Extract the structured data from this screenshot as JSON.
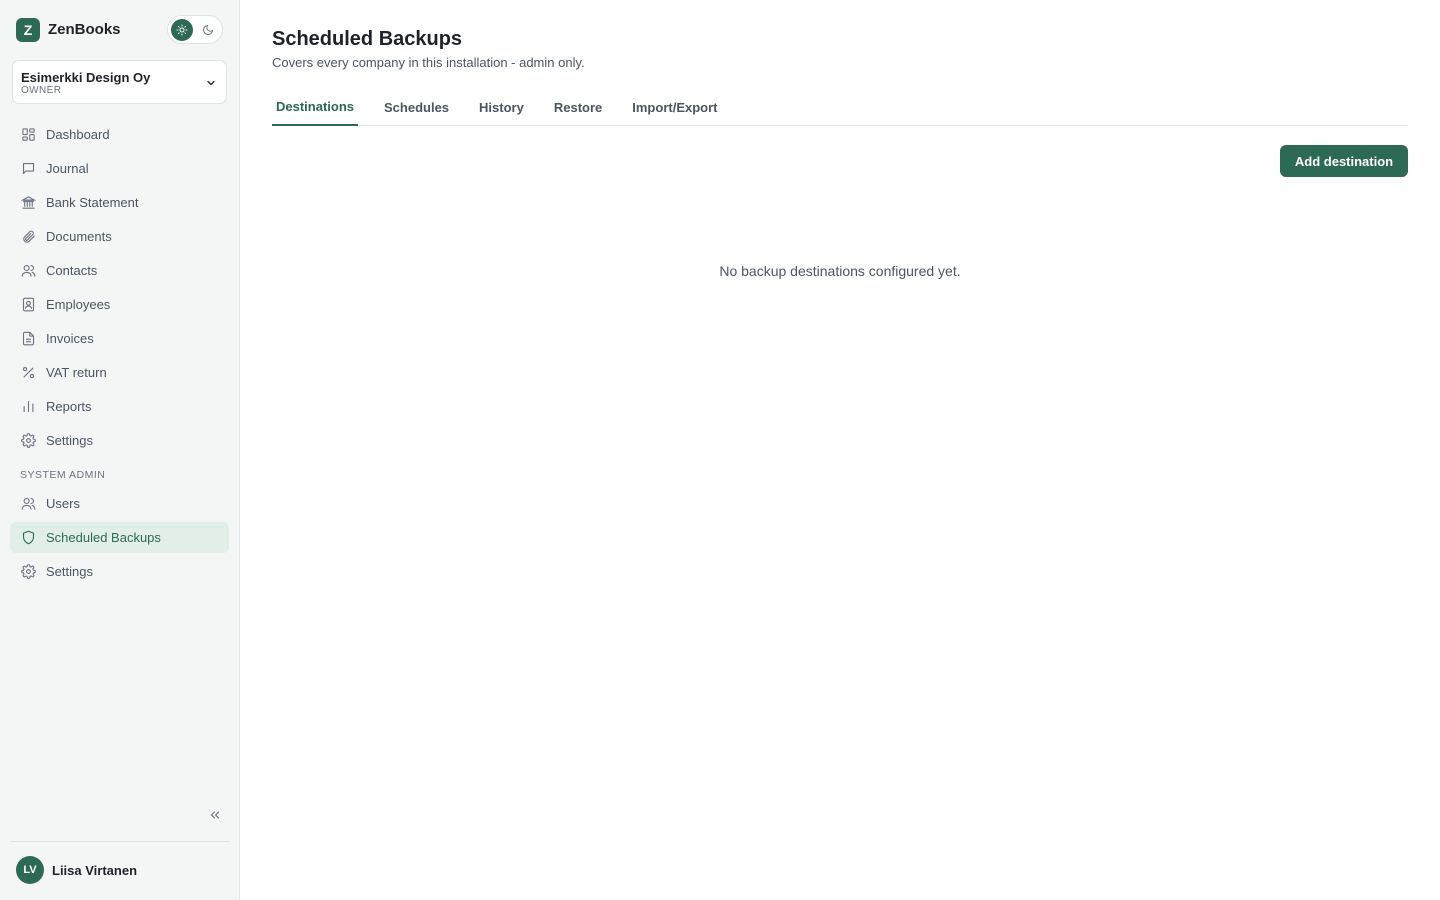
{
  "app": {
    "logo_letter": "Z",
    "name": "ZenBooks"
  },
  "theme": {
    "light_icon": "sun-icon",
    "dark_icon": "moon-icon",
    "active": "light"
  },
  "company": {
    "name": "Esimerkki Design Oy",
    "role": "OWNER"
  },
  "nav": [
    {
      "label": "Dashboard",
      "icon": "dashboard-icon"
    },
    {
      "label": "Journal",
      "icon": "journal-icon"
    },
    {
      "label": "Bank Statement",
      "icon": "bank-icon"
    },
    {
      "label": "Documents",
      "icon": "paperclip-icon"
    },
    {
      "label": "Contacts",
      "icon": "users-icon"
    },
    {
      "label": "Employees",
      "icon": "id-badge-icon"
    },
    {
      "label": "Invoices",
      "icon": "file-icon"
    },
    {
      "label": "VAT return",
      "icon": "percent-icon"
    },
    {
      "label": "Reports",
      "icon": "bar-chart-icon"
    },
    {
      "label": "Settings",
      "icon": "gear-icon"
    }
  ],
  "system_admin": {
    "label": "SYSTEM ADMIN",
    "items": [
      {
        "label": "Users",
        "icon": "users-icon"
      },
      {
        "label": "Scheduled Backups",
        "icon": "shield-icon",
        "active": true
      },
      {
        "label": "Settings",
        "icon": "gear-icon"
      }
    ]
  },
  "user": {
    "initials": "LV",
    "name": "Liisa Virtanen"
  },
  "page": {
    "title": "Scheduled Backups",
    "subtitle": "Covers every company in this installation - admin only.",
    "tabs": [
      {
        "label": "Destinations",
        "active": true
      },
      {
        "label": "Schedules"
      },
      {
        "label": "History"
      },
      {
        "label": "Restore"
      },
      {
        "label": "Import/Export"
      }
    ],
    "add_button": "Add destination",
    "empty_message": "No backup destinations configured yet."
  },
  "colors": {
    "accent": "#2d6a55",
    "accent_soft": "#e2efe9",
    "sidebar_bg": "#f4f6f6"
  }
}
